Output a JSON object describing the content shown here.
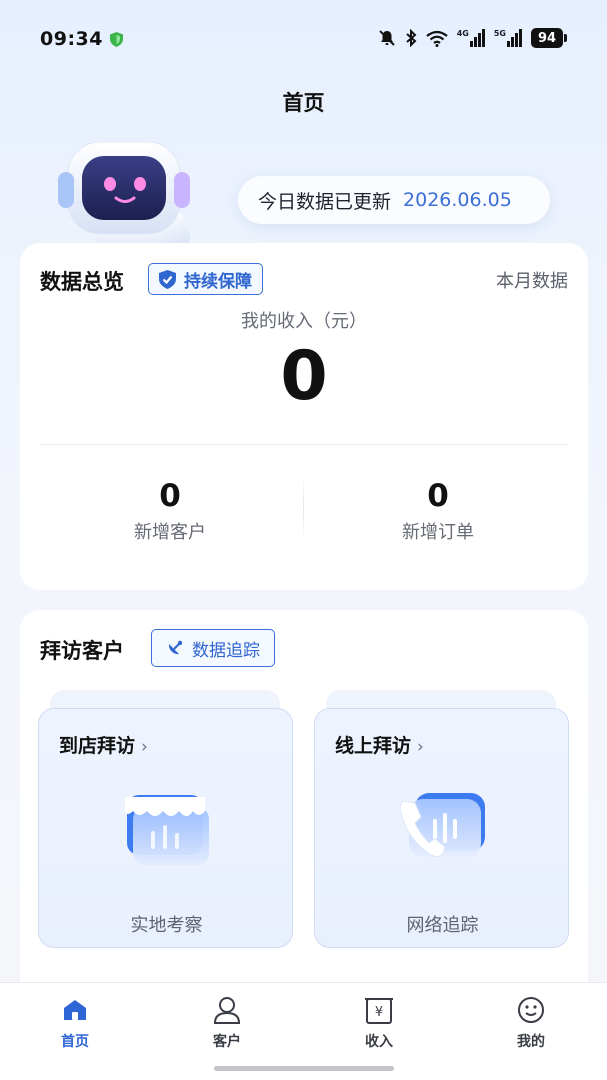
{
  "status_bar": {
    "time": "09:34",
    "battery": "94",
    "signal_a": "4G",
    "signal_b": "5G"
  },
  "header": {
    "title": "首页"
  },
  "update": {
    "label": "今日数据已更新",
    "date": "2026.06.05"
  },
  "overview": {
    "title": "数据总览",
    "badge": "持续保障",
    "period": "本月数据",
    "income_label": "我的收入（元）",
    "income_value": "0",
    "stats": [
      {
        "value": "0",
        "label": "新增客户"
      },
      {
        "value": "0",
        "label": "新增订单"
      }
    ]
  },
  "visit": {
    "title": "拜访客户",
    "badge": "数据追踪",
    "tiles": [
      {
        "title": "到店拜访",
        "chevron": "›",
        "caption": "实地考察",
        "icon": "store-icon"
      },
      {
        "title": "线上拜访",
        "chevron": "›",
        "caption": "网络追踪",
        "icon": "phone-chat-icon"
      }
    ]
  },
  "tabbar": {
    "items": [
      {
        "label": "首页",
        "icon": "home-icon",
        "active": true
      },
      {
        "label": "客户",
        "icon": "person-icon",
        "active": false
      },
      {
        "label": "收入",
        "icon": "yen-receipt-icon",
        "active": false
      },
      {
        "label": "我的",
        "icon": "smile-icon",
        "active": false
      }
    ]
  },
  "colors": {
    "accent": "#2f66d6",
    "date": "#3b6fd6",
    "background": "#f1f5fc"
  }
}
